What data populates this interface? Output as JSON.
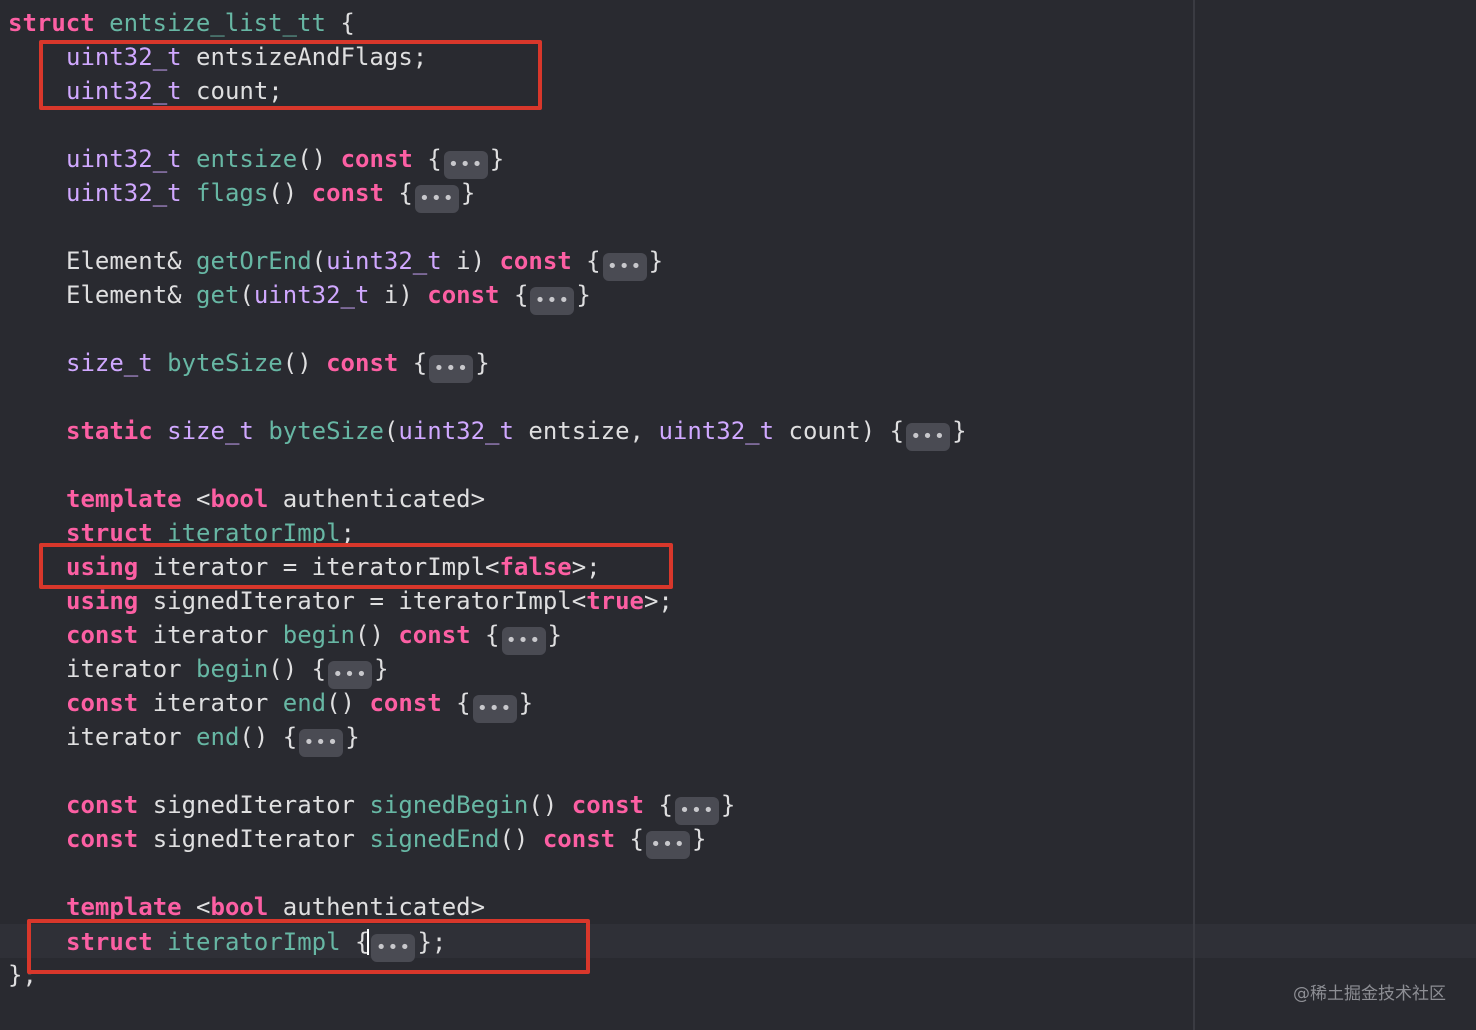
{
  "code": {
    "l01": {
      "a": "struct",
      "b": " ",
      "c": "entsize_list_tt",
      "d": " {"
    },
    "l02": {
      "a": "uint32_t",
      "b": " entsizeAndFlags;"
    },
    "l03": {
      "a": "uint32_t",
      "b": " count;"
    },
    "l05": {
      "a": "uint32_t",
      "b": " ",
      "c": "entsize",
      "d": "() ",
      "e": "const",
      "f": " {",
      "g": "}"
    },
    "l06": {
      "a": "uint32_t",
      "b": " ",
      "c": "flags",
      "d": "() ",
      "e": "const",
      "f": " {",
      "g": "}"
    },
    "l08": {
      "a": "Element& ",
      "b": "getOrEnd",
      "c": "(",
      "d": "uint32_t",
      "e": " i) ",
      "f": "const",
      "g": " {",
      "h": "}"
    },
    "l09": {
      "a": "Element& ",
      "b": "get",
      "c": "(",
      "d": "uint32_t",
      "e": " i) ",
      "f": "const",
      "g": " {",
      "h": "}"
    },
    "l11": {
      "a": "size_t",
      "b": " ",
      "c": "byteSize",
      "d": "() ",
      "e": "const",
      "f": " {",
      "g": "}"
    },
    "l13": {
      "a": "static",
      "b": " ",
      "c": "size_t",
      "d": " ",
      "e": "byteSize",
      "f": "(",
      "g": "uint32_t",
      "h": " entsize, ",
      "i": "uint32_t",
      "j": " count) {",
      "k": "}"
    },
    "l15": {
      "a": "template",
      "b": " <",
      "c": "bool",
      "d": " authenticated>"
    },
    "l16": {
      "a": "struct",
      "b": " ",
      "c": "iteratorImpl",
      "d": ";"
    },
    "l17": {
      "a": "using",
      "b": " iterator = iteratorImpl<",
      "c": "false",
      "d": ">;"
    },
    "l18": {
      "a": "using",
      "b": " signedIterator = iteratorImpl<",
      "c": "true",
      "d": ">;"
    },
    "l19": {
      "a": "const",
      "b": " iterator ",
      "c": "begin",
      "d": "() ",
      "e": "const",
      "f": " {",
      "g": "}"
    },
    "l20": {
      "a": "iterator ",
      "b": "begin",
      "c": "() {",
      "d": "}"
    },
    "l21": {
      "a": "const",
      "b": " iterator ",
      "c": "end",
      "d": "() ",
      "e": "const",
      "f": " {",
      "g": "}"
    },
    "l22": {
      "a": "iterator ",
      "b": "end",
      "c": "() {",
      "d": "}"
    },
    "l24": {
      "a": "const",
      "b": " signedIterator ",
      "c": "signedBegin",
      "d": "() ",
      "e": "const",
      "f": " {",
      "g": "}"
    },
    "l25": {
      "a": "const",
      "b": " signedIterator ",
      "c": "signedEnd",
      "d": "() ",
      "e": "const",
      "f": " {",
      "g": "}"
    },
    "l27": {
      "a": "template",
      "b": " <",
      "c": "bool",
      "d": " authenticated>"
    },
    "l28": {
      "a": "struct",
      "b": " ",
      "c": "iteratorImpl",
      "d": " {",
      "e": "};"
    },
    "l29": {
      "a": "};"
    }
  },
  "fold_label": "•••",
  "watermark": "@稀土掘金技术社区",
  "colors": {
    "background": "#292a30",
    "keyword": "#fc5fa3",
    "type": "#d0a8ff",
    "function": "#67b7a4",
    "plain": "#dfdfe0",
    "highlight_box": "#d8372b"
  }
}
